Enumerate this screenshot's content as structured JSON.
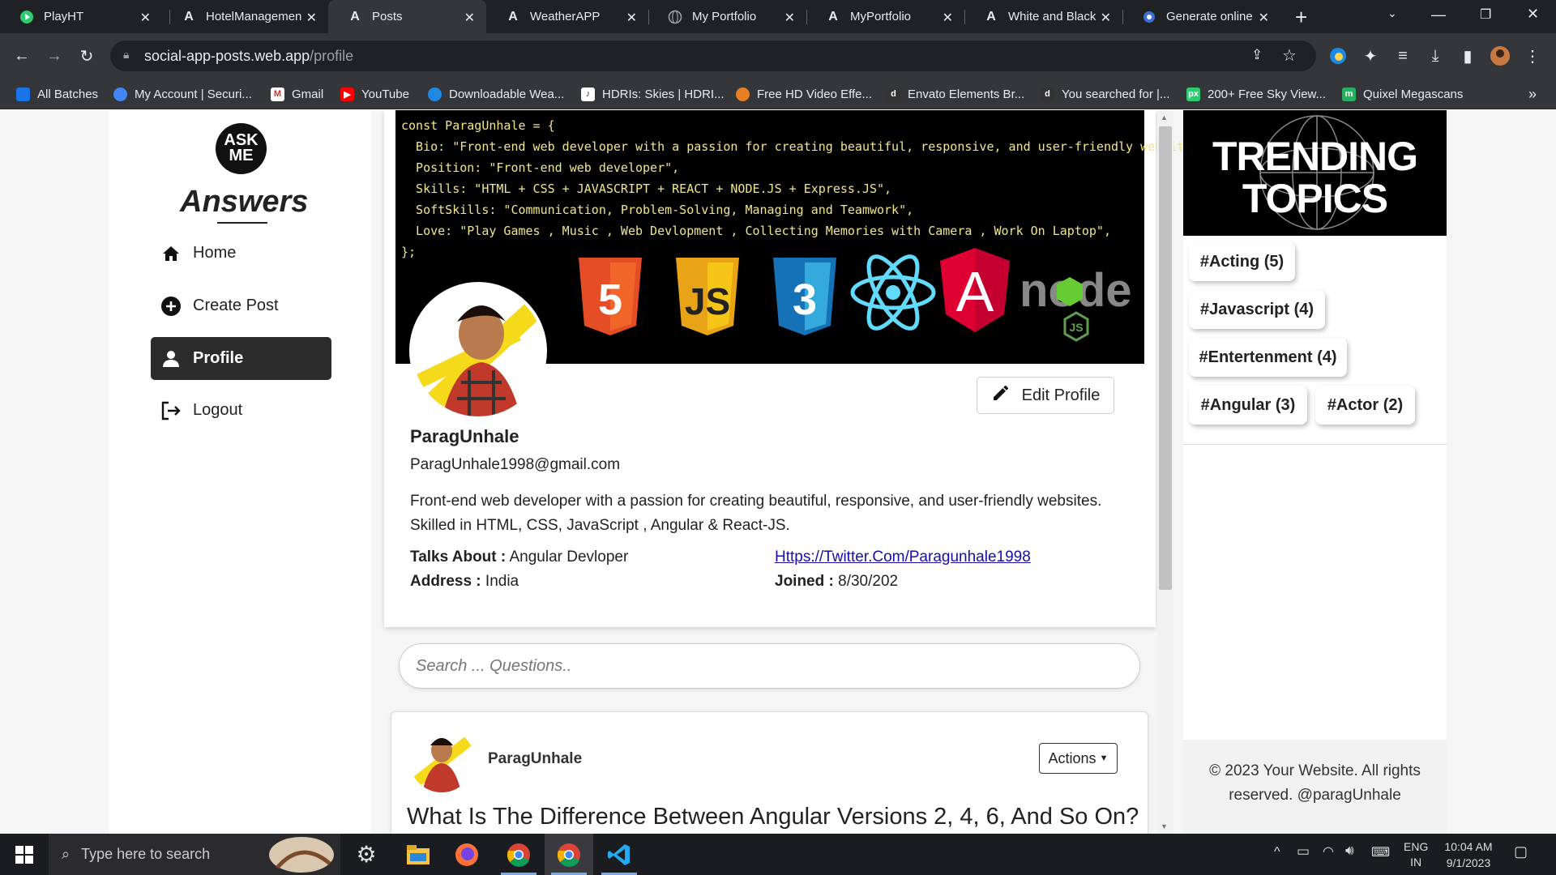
{
  "browser": {
    "tabs": [
      {
        "title": "PlayHT",
        "icon": "playht-icon"
      },
      {
        "title": "HotelManagemen",
        "icon": "angular-a-icon"
      },
      {
        "title": "Posts",
        "icon": "angular-a-icon"
      },
      {
        "title": "WeatherAPP",
        "icon": "angular-a-icon"
      },
      {
        "title": "My Portfolio",
        "icon": "globe-icon"
      },
      {
        "title": "MyPortfolio",
        "icon": "angular-a-icon"
      },
      {
        "title": "White and Black",
        "icon": "angular-a-icon"
      },
      {
        "title": "Generate online",
        "icon": "openart-icon"
      }
    ],
    "url_host": "social-app-posts.web.app",
    "url_path": "/profile",
    "bookmarks": [
      "All Batches",
      "My Account | Securi...",
      "Gmail",
      "YouTube",
      "Downloadable Wea...",
      "HDRIs: Skies | HDRI...",
      "Free HD Video Effe...",
      "Envato Elements Br...",
      "You searched for |...",
      "200+ Free Sky View...",
      "Quixel Megascans"
    ],
    "bookmarks_more": "»"
  },
  "sidebar": {
    "logo_line1": "ASK",
    "logo_line2": "ME",
    "logo_word": "Answers",
    "nav": [
      {
        "label": "Home",
        "icon": "home-icon"
      },
      {
        "label": "Create Post",
        "icon": "plus-circle-icon"
      },
      {
        "label": "Profile",
        "icon": "user-icon"
      },
      {
        "label": "Logout",
        "icon": "logout-icon"
      }
    ]
  },
  "banner": {
    "code_lines": [
      "const ParagUnhale = {",
      "  Bio: \"Front-end web developer with a passion for creating beautiful, responsive, and user-friendly websites\",",
      "  Position: \"Front-end web developer\",",
      "  Skills: \"HTML + CSS + JAVASCRIPT + REACT + NODE.JS + Express.JS\",",
      "  SoftSkills: \"Communication, Problem-Solving, Managing and Teamwork\",",
      "  Love: \"Play Games , Music , Web Devlopment , Collecting Memories with Camera , Work On Laptop\",",
      "};"
    ],
    "html5_glyph": "5",
    "js_glyph": "JS",
    "css3_glyph": "3",
    "angular_glyph": "A",
    "node_word": "node",
    "node_sub": "JS"
  },
  "profile": {
    "edit_label": "Edit Profile",
    "name": "ParagUnhale",
    "email": "ParagUnhale1998@gmail.com",
    "bio": "Front-end web developer with a passion for creating beautiful, responsive, and user-friendly websites. Skilled in HTML, CSS, JavaScript , Angular & React-JS.",
    "talks_label": "Talks About :",
    "talks_value": "Angular Devloper",
    "address_label": "Address :",
    "address_value": "India",
    "twitter": "Https://Twitter.Com/Paragunhale1998",
    "joined_label": "Joined :",
    "joined_value": "8/30/202"
  },
  "search": {
    "placeholder": "Search ... Questions.."
  },
  "post": {
    "author": "ParagUnhale",
    "actions_label": "Actions",
    "title": "What Is The Difference Between Angular Versions 2, 4, 6, And So On?"
  },
  "trending": {
    "line1": "TRENDING",
    "line2": "TOPICS",
    "tags": [
      "#Acting (5)",
      "#Javascript (4)",
      "#Entertenment (4)",
      "#Angular (3)",
      "#Actor (2)"
    ]
  },
  "footer": {
    "text": "© 2023 Your Website. All rights reserved. @paragUnhale"
  },
  "taskbar": {
    "search_placeholder": "Type here to search",
    "lang1": "ENG",
    "lang2": "IN",
    "time": "10:04 AM",
    "date": "9/1/2023"
  },
  "colors": {
    "browser_dark": "#202124",
    "toolbar": "#35363a",
    "accent_nav": "#2b2b2b",
    "link": "#1a0dab"
  }
}
